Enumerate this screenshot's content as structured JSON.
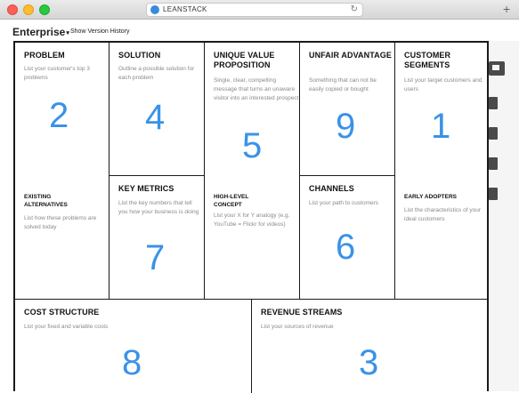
{
  "browser": {
    "address": "LEANSTACK",
    "reload_glyph": "↻",
    "new_tab_glyph": "+"
  },
  "toolbar": {
    "canvas_name": "Enterprise",
    "caret": "▾",
    "history_link": "Show Version History"
  },
  "blocks": {
    "problem": {
      "title": "PROBLEM",
      "desc": "List your customer's top 3 problems",
      "number": "2",
      "sub_title": "EXISTING ALTERNATIVES",
      "sub_desc": "List how these problems are solved today"
    },
    "solution": {
      "title": "SOLUTION",
      "desc": "Outline a possible solution for each problem",
      "number": "4"
    },
    "key_metrics": {
      "title": "KEY METRICS",
      "desc": "List the key numbers that tell you how your business is doing",
      "number": "7"
    },
    "uvp": {
      "title": "UNIQUE VALUE PROPOSITION",
      "desc": "Single, clear, compelling message that turns an unaware visitor into an interested prospect",
      "number": "5",
      "sub_title": "HIGH-LEVEL CONCEPT",
      "sub_desc": "List your X for Y analogy (e.g. YouTube = Flickr for videos)"
    },
    "unfair_advantage": {
      "title": "UNFAIR ADVANTAGE",
      "desc": "Something that can not be easily copied or bought",
      "number": "9"
    },
    "channels": {
      "title": "CHANNELS",
      "desc": "List your path to customers",
      "number": "6"
    },
    "customer_segments": {
      "title": "CUSTOMER SEGMENTS",
      "desc": "List your target customers and users",
      "number": "1",
      "sub_title": "EARLY ADOPTERS",
      "sub_desc": "List the characteristics of your ideal customers"
    },
    "cost_structure": {
      "title": "COST STRUCTURE",
      "desc": "List your fixed and variable costs",
      "number": "8"
    },
    "revenue_streams": {
      "title": "REVENUE STREAMS",
      "desc": "List your sources of revenue",
      "number": "3"
    }
  },
  "colors": {
    "accent_number": "#3a92e8",
    "border": "#1a1a1a",
    "description": "#8a8a8a"
  }
}
